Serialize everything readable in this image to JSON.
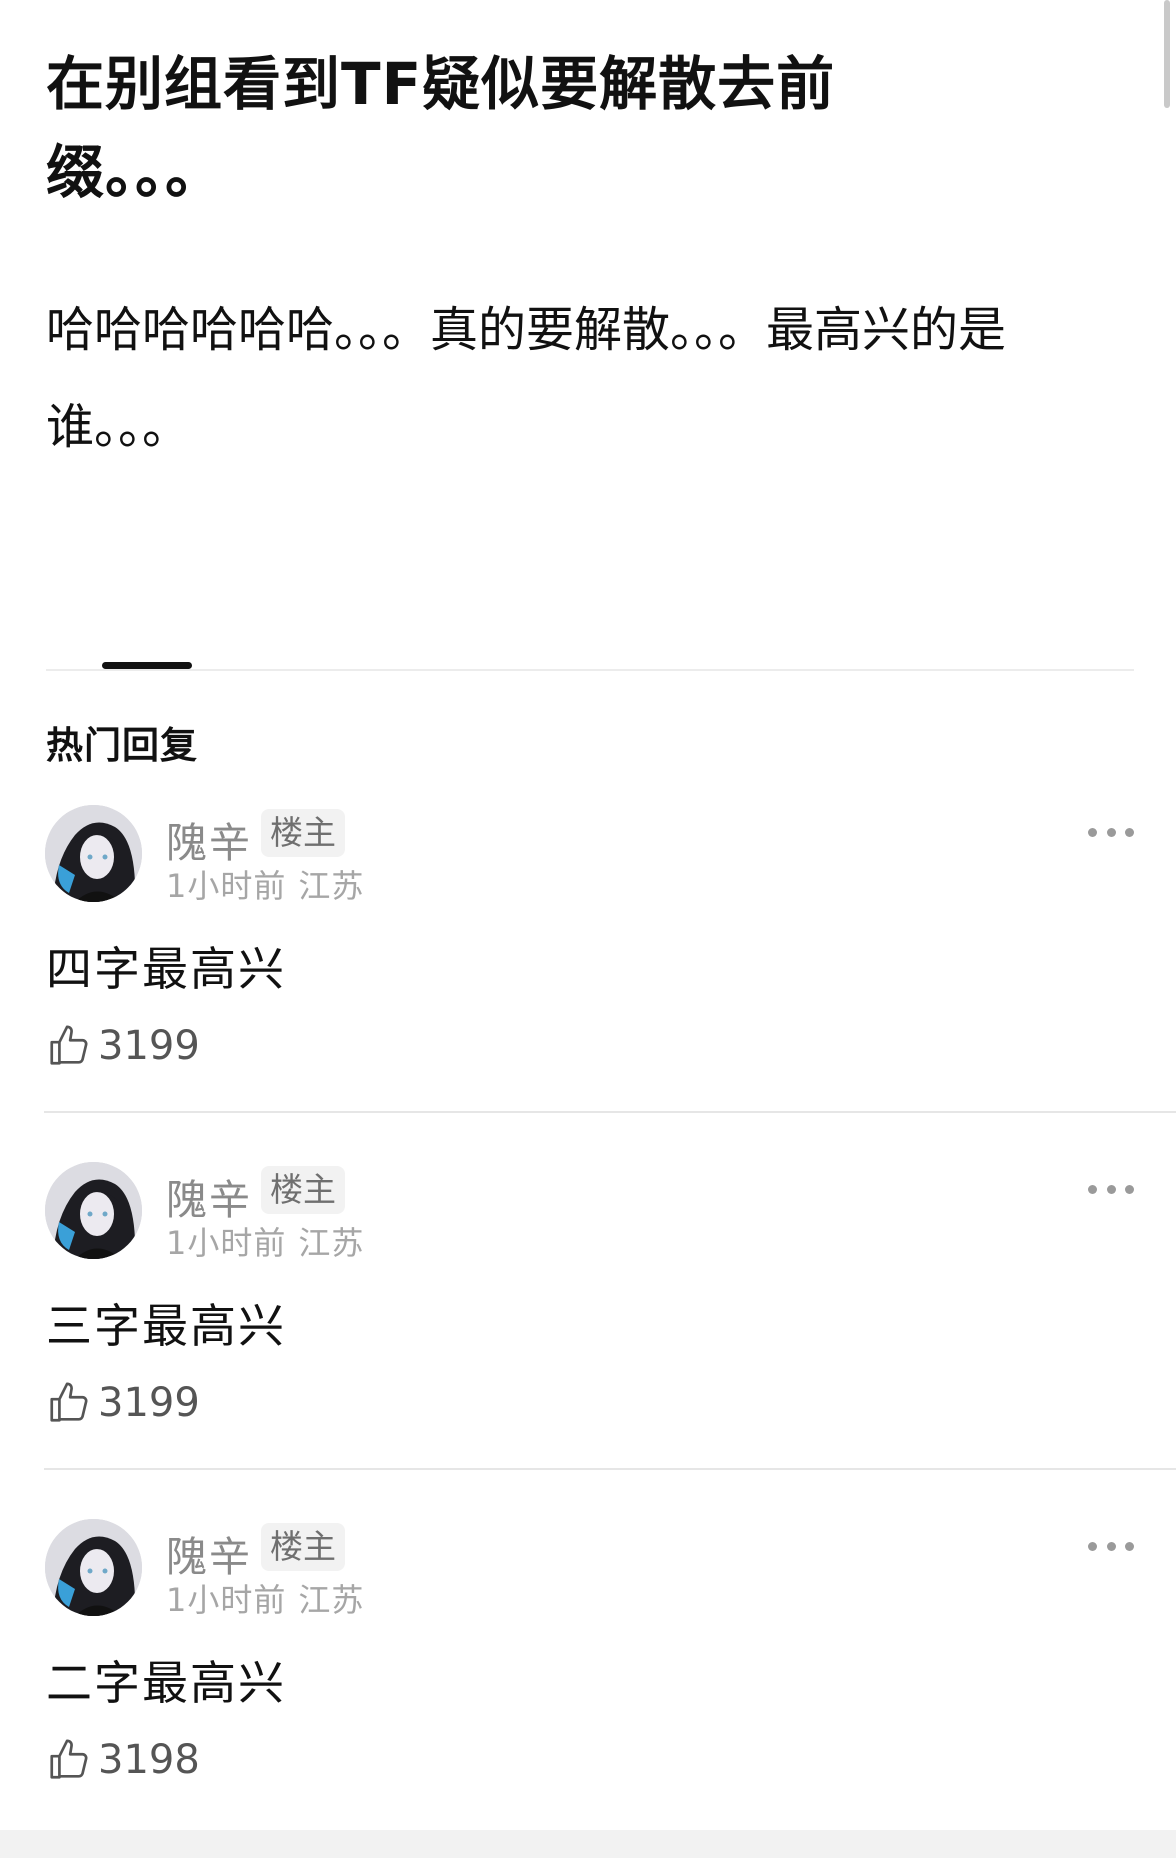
{
  "post": {
    "title": "在别组看到TF疑似要解散去前缀。。。",
    "body": "哈哈哈哈哈哈。。。真的要解散。。。最高兴的是谁。。。"
  },
  "replies_section": {
    "heading": "热门回复"
  },
  "replies": [
    {
      "username": "隗辛",
      "badge": "楼主",
      "time": "1小时前",
      "location": "江苏",
      "text": "四字最高兴",
      "likes": "3199"
    },
    {
      "username": "隗辛",
      "badge": "楼主",
      "time": "1小时前",
      "location": "江苏",
      "text": "三字最高兴",
      "likes": "3199"
    },
    {
      "username": "隗辛",
      "badge": "楼主",
      "time": "1小时前",
      "location": "江苏",
      "text": "二字最高兴",
      "likes": "3198"
    }
  ],
  "icons": {
    "more": "more-horizontal-icon",
    "like": "thumbs-up-icon"
  },
  "colors": {
    "text": "#111111",
    "secondary_text": "#8a8a8a",
    "badge_background": "#f2f2f2"
  }
}
